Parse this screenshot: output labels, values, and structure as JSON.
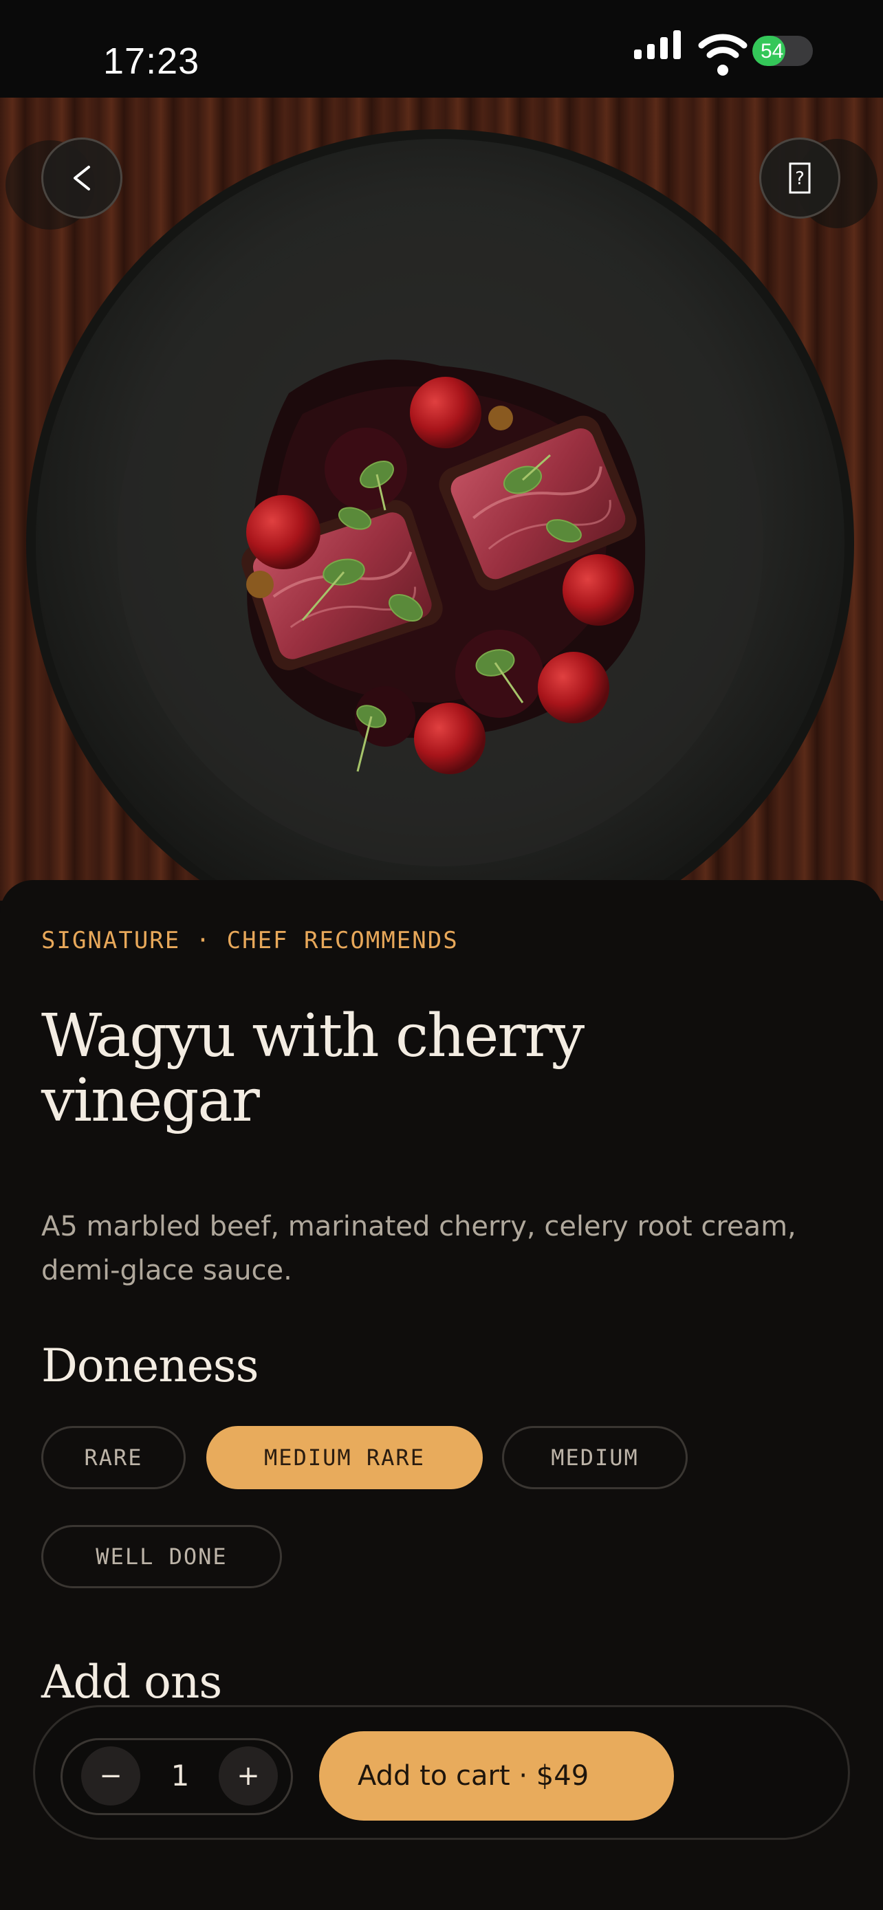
{
  "status_bar": {
    "time": "17:23",
    "battery_level": "54",
    "battery_fraction": 0.54,
    "icons": [
      "signal-icon",
      "wifi-icon",
      "battery-icon"
    ]
  },
  "hero": {
    "image_description": "plated wagyu with cherries on dark plate",
    "back_icon": "back-chevron-icon",
    "back_label": "<",
    "help_icon": "help-icon",
    "help_label": "?"
  },
  "dish": {
    "eyebrow": "SIGNATURE · CHEF RECOMMENDS",
    "title": "Wagyu with cherry vinegar",
    "description": "A5 marbled beef, marinated cherry, celery root cream, demi-glace sauce."
  },
  "doneness": {
    "title": "Doneness",
    "options": [
      "RARE",
      "MEDIUM RARE",
      "MEDIUM",
      "WELL DONE"
    ],
    "selected": "MEDIUM RARE"
  },
  "addons": {
    "title": "Add ons"
  },
  "cart": {
    "quantity": "1",
    "minus_label": "−",
    "plus_label": "+",
    "button_label": "Add to cart · $49"
  },
  "colors": {
    "accent": "#e8ab5c",
    "background": "#0f0d0c",
    "battery": "#34c759"
  }
}
